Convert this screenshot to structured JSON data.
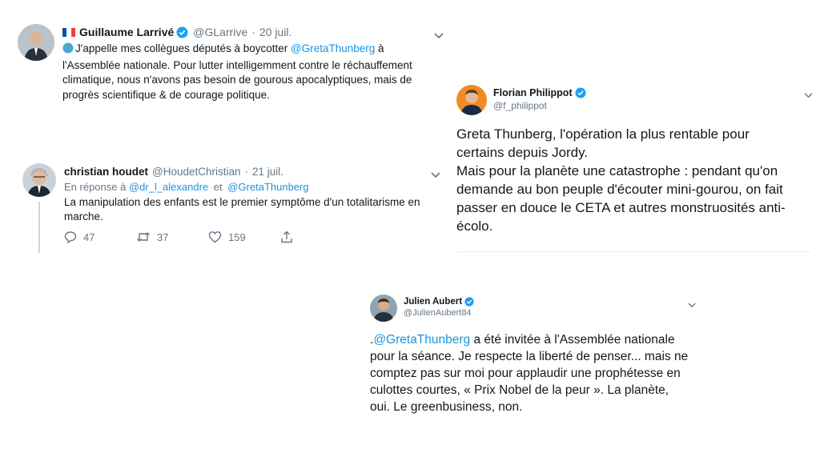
{
  "tweets": [
    {
      "name": "Guillaume Larrivé",
      "handle": "@GLarrive",
      "sep": "·",
      "date": "20 juil.",
      "text_lines": [
        "J'appelle mes collègues députés à boycotter ",
        "l'Assemblée nationale. Pour lutter intelligemment contre le réchauffement",
        "climatique, nous n'avons pas besoin de gourous apocalyptiques, mais de",
        "progrès scientifique & de courage politique."
      ],
      "mention": "@GretaThunberg",
      "after_mention": " à",
      "emoji": "globe-icon",
      "flag": "france-flag-icon"
    },
    {
      "name": "christian houdet",
      "handle": "@HoudetChristian",
      "sep": "·",
      "date": "21 juil.",
      "reply_prefix": "En réponse à ",
      "reply_to_1": "@dr_l_alexandre",
      "reply_join": " et ",
      "reply_to_2": "@GretaThunberg",
      "text_lines": [
        "La manipulation des enfants est le premier symptôme d'un totalitarisme en",
        "marche."
      ],
      "replies": "47",
      "retweets": "37",
      "likes": "159"
    },
    {
      "name": "Florian Philippot",
      "handle": "@f_philippot",
      "text_lines": [
        "Greta Thunberg, l'opération la plus rentable pour",
        "certains depuis Jordy.",
        "Mais pour la planète une catastrophe : pendant qu'on",
        "demande au bon peuple d'écouter mini-gourou, on fait",
        "passer en douce le CETA et autres monstruosités anti-",
        "écolo."
      ]
    },
    {
      "name": "Julien Aubert",
      "handle": "@JulienAubert84",
      "lead": ".",
      "mention": "@GretaThunberg",
      "first_line_rest": " a été invitée à l'Assemblée nationale",
      "text_lines": [
        "pour la séance. Je respecte la liberté de penser... mais ne",
        "comptez pas sur moi pour applaudir une prophétesse en",
        "culottes courtes, « Prix Nobel de la peur ». La planète,",
        "oui. Le greenbusiness, non."
      ]
    }
  ],
  "colors": {
    "link": "#1b95e0",
    "muted": "#657786",
    "verified": "#1da1f2"
  }
}
